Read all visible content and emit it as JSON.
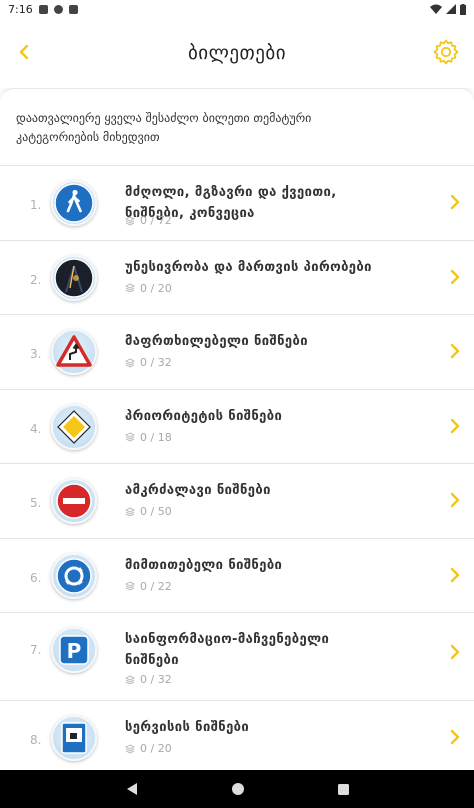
{
  "status_bar": {
    "time": "7:16"
  },
  "header": {
    "title": "ბილეთები",
    "back_icon": "chevron-left-icon",
    "settings_icon": "gear-icon"
  },
  "description": "დაათვალიერე ყველა შესაძლო ბილეთი თემატური კატეგორიების მიხედვით",
  "colors": {
    "accent": "#F5C518",
    "text": "#333333",
    "muted": "#A8A8A8",
    "divider": "#E3E3E3"
  },
  "categories": [
    {
      "number": "1.",
      "title": "მძღოლი, მგზავრი და ქვეითი, ნიშნები, კონვეცია",
      "progress": "0 / 72",
      "icon": "pedestrian-sign-icon"
    },
    {
      "number": "2.",
      "title": "უნესივრობა და მართვის პირობები",
      "progress": "0 / 20",
      "icon": "night-road-icon"
    },
    {
      "number": "3.",
      "title": "მაფრთხილებელი ნიშნები",
      "progress": "0 / 32",
      "icon": "warning-sign-icon"
    },
    {
      "number": "4.",
      "title": "პრიორიტეტის ნიშნები",
      "progress": "0 / 18",
      "icon": "priority-road-sign-icon"
    },
    {
      "number": "5.",
      "title": "ამკრძალავი ნიშნები",
      "progress": "0 / 50",
      "icon": "no-entry-sign-icon"
    },
    {
      "number": "6.",
      "title": "მიმთითებელი ნიშნები",
      "progress": "0 / 22",
      "icon": "roundabout-sign-icon"
    },
    {
      "number": "7.",
      "title": "საინფორმაციო-მაჩვენებელი ნიშნები",
      "progress": "0 / 32",
      "icon": "parking-sign-icon"
    },
    {
      "number": "8.",
      "title": "სერვისის ნიშნები",
      "progress": "0 / 20",
      "icon": "service-sign-icon"
    }
  ]
}
